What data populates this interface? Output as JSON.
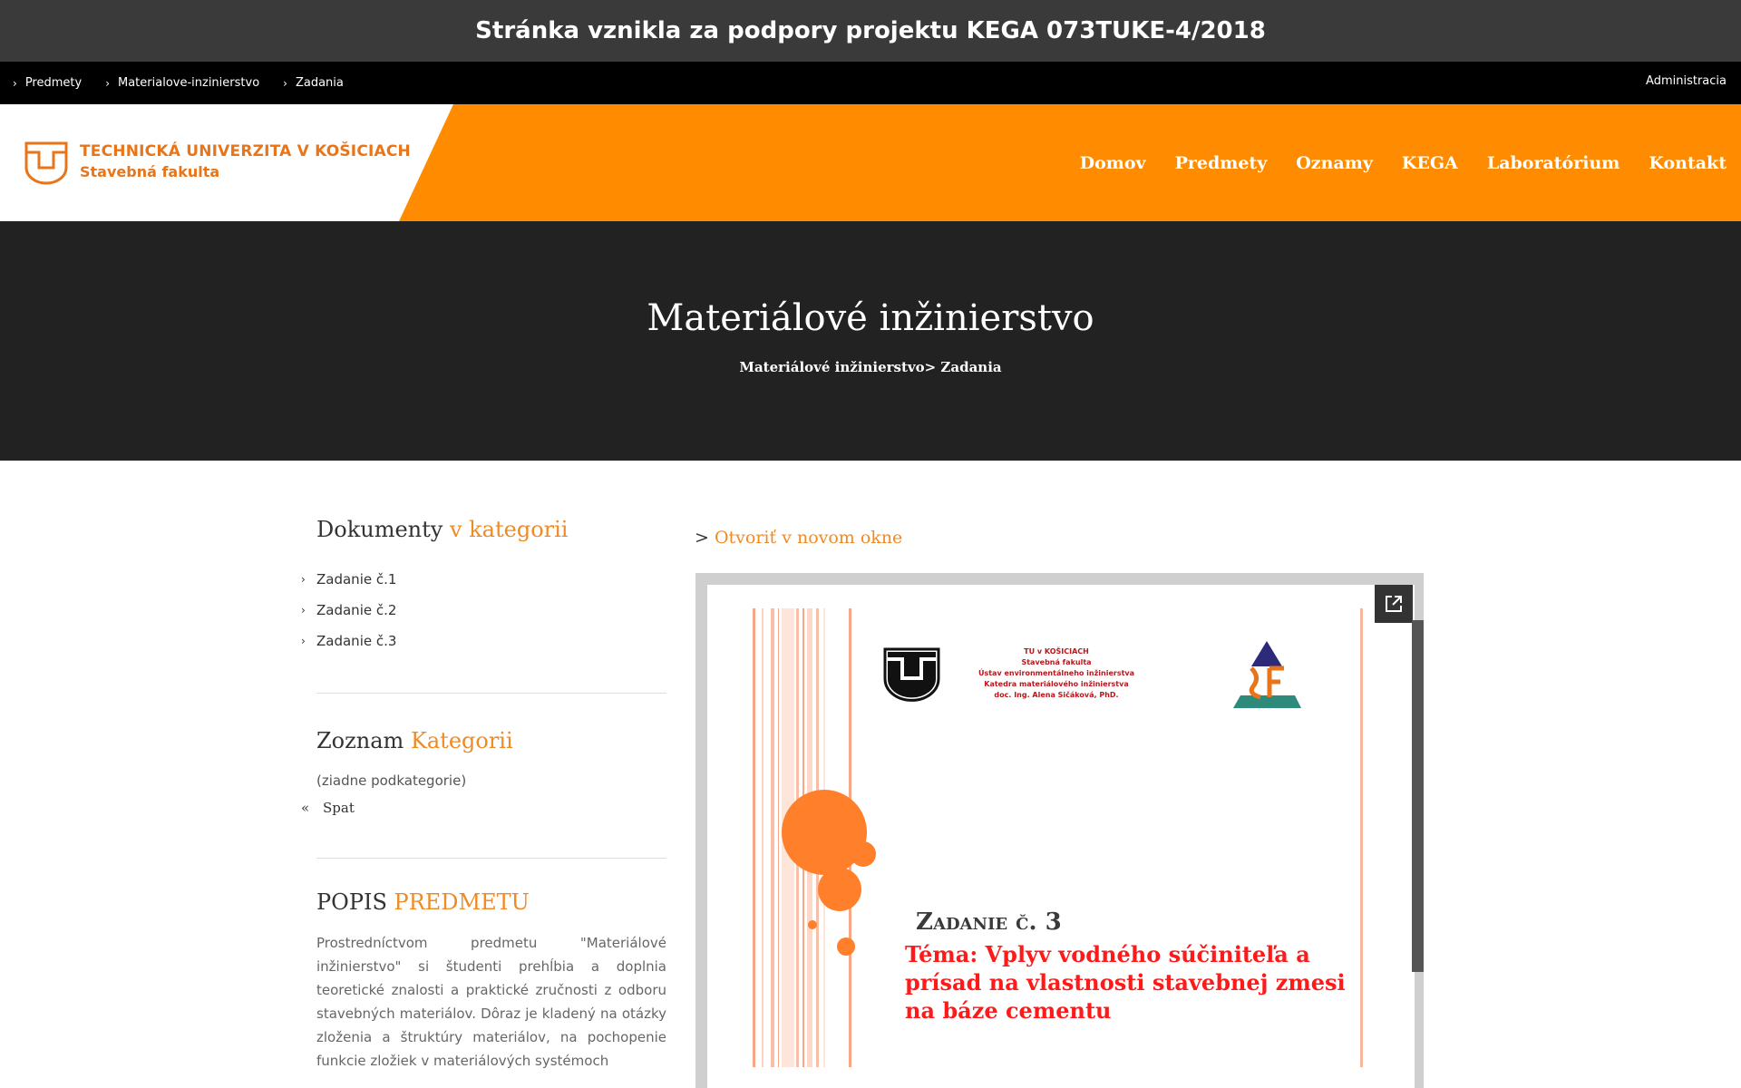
{
  "banner": {
    "text": "Stránka vznikla za podpory projektu KEGA 073TUKE-4/2018"
  },
  "breadcrumbs": {
    "items": [
      "Predmety",
      "Materialove-inzinierstvo",
      "Zadania"
    ],
    "admin": "Administracia"
  },
  "header": {
    "logo_line1": "TECHNICKÁ UNIVERZITA V KOŠICIACH",
    "logo_line2": "Stavebná fakulta",
    "nav": [
      "Domov",
      "Predmety",
      "Oznamy",
      "KEGA",
      "Laboratórium",
      "Kontakt"
    ]
  },
  "hero": {
    "title": "Materiálové inžinierstvo",
    "subtitle": "Materiálové inžinierstvo> Zadania"
  },
  "sidebar": {
    "documents_heading": "Dokumenty",
    "documents_heading_accent": "v kategorii",
    "documents": [
      "Zadanie č.1",
      "Zadanie č.2",
      "Zadanie č.3"
    ],
    "categories_heading": "Zoznam",
    "categories_heading_accent": "Kategorii",
    "no_subcategories": "(ziadne podkategorie)",
    "back_label": "Spat",
    "description_heading": "POPIS",
    "description_heading_accent": "PREDMETU",
    "description_text": "Prostredníctvom predmetu \"Materiálové inžinierstvo\" si študenti prehĺbia a doplnia teoretické znalosti a praktické zručnosti z odboru stavebných materiálov. Dôraz je kladený na otázky zloženia a štruktúry materiálov, na pochopenie funkcie zložiek v materiálových systémoch"
  },
  "content": {
    "open_prefix": ">",
    "open_link": "Otvoriť v novom okne",
    "slide": {
      "inst_line1": "TU v KOŠICIACH",
      "inst_line2": "Stavebná fakulta",
      "inst_line3": "Ústav environmentálneho inžinierstva",
      "inst_line4": "Katedra materiálového inžinierstva",
      "inst_line5": "doc. Ing. Alena Sičáková, PhD.",
      "title": "Zadanie č. 3",
      "topic": "Téma: Vplyv vodného súčiniteľa a prísad na vlastnosti stavebnej zmesi na báze cementu"
    }
  },
  "colors": {
    "accent": "#ff8c00",
    "dark": "#222222",
    "banner": "#3a3a3a",
    "slide_red": "#ff1a1a",
    "circle": "#ff7f2a"
  }
}
